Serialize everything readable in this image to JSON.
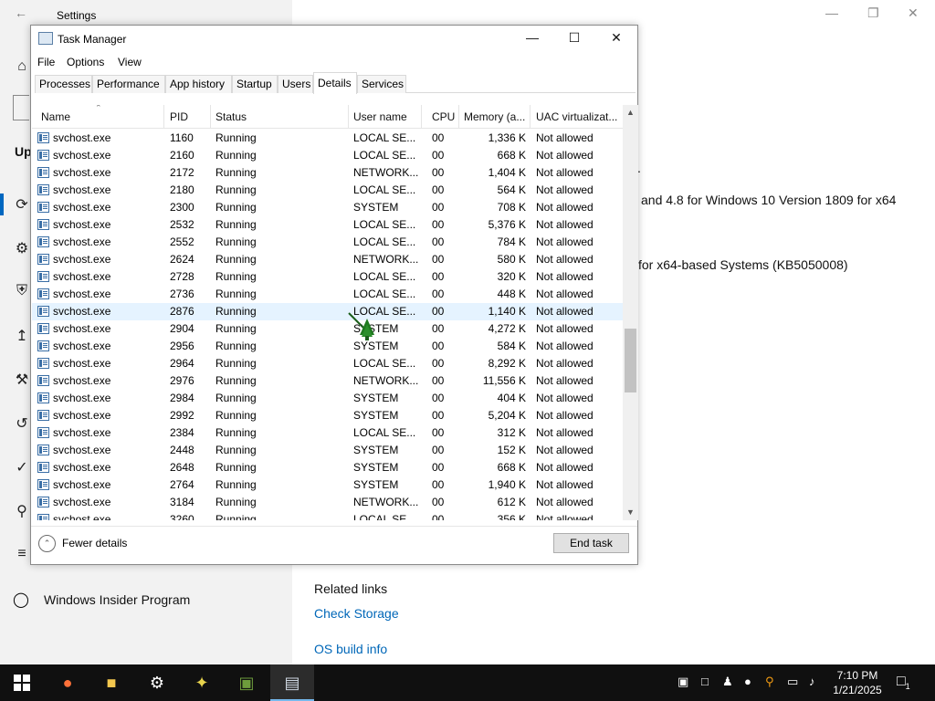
{
  "settings": {
    "title": "Settings",
    "partial_heading": "Up",
    "text_line_1": "and 4.8 for Windows 10 Version 1809 for x64",
    "text_line_2": "for x64-based Systems (KB5050008)",
    "text_dot": ".",
    "related_links": "Related links",
    "check_storage": "Check Storage",
    "os_build_info": "OS build info",
    "insider_program": "Windows Insider Program"
  },
  "task_manager": {
    "title": "Task Manager",
    "menu": [
      "File",
      "Options",
      "View"
    ],
    "tabs": [
      "Processes",
      "Performance",
      "App history",
      "Startup",
      "Users",
      "Details",
      "Services"
    ],
    "active_tab": "Details",
    "columns": [
      "Name",
      "PID",
      "Status",
      "User name",
      "CPU",
      "Memory (a...",
      "UAC virtualizat..."
    ],
    "rows": [
      {
        "name": "svchost.exe",
        "pid": "1160",
        "status": "Running",
        "user": "LOCAL SE...",
        "cpu": "00",
        "memory": "1,336 K",
        "uac": "Not allowed"
      },
      {
        "name": "svchost.exe",
        "pid": "2160",
        "status": "Running",
        "user": "LOCAL SE...",
        "cpu": "00",
        "memory": "668 K",
        "uac": "Not allowed"
      },
      {
        "name": "svchost.exe",
        "pid": "2172",
        "status": "Running",
        "user": "NETWORK...",
        "cpu": "00",
        "memory": "1,404 K",
        "uac": "Not allowed"
      },
      {
        "name": "svchost.exe",
        "pid": "2180",
        "status": "Running",
        "user": "LOCAL SE...",
        "cpu": "00",
        "memory": "564 K",
        "uac": "Not allowed"
      },
      {
        "name": "svchost.exe",
        "pid": "2300",
        "status": "Running",
        "user": "SYSTEM",
        "cpu": "00",
        "memory": "708 K",
        "uac": "Not allowed"
      },
      {
        "name": "svchost.exe",
        "pid": "2532",
        "status": "Running",
        "user": "LOCAL SE...",
        "cpu": "00",
        "memory": "5,376 K",
        "uac": "Not allowed"
      },
      {
        "name": "svchost.exe",
        "pid": "2552",
        "status": "Running",
        "user": "LOCAL SE...",
        "cpu": "00",
        "memory": "784 K",
        "uac": "Not allowed"
      },
      {
        "name": "svchost.exe",
        "pid": "2624",
        "status": "Running",
        "user": "NETWORK...",
        "cpu": "00",
        "memory": "580 K",
        "uac": "Not allowed"
      },
      {
        "name": "svchost.exe",
        "pid": "2728",
        "status": "Running",
        "user": "LOCAL SE...",
        "cpu": "00",
        "memory": "320 K",
        "uac": "Not allowed"
      },
      {
        "name": "svchost.exe",
        "pid": "2736",
        "status": "Running",
        "user": "LOCAL SE...",
        "cpu": "00",
        "memory": "448 K",
        "uac": "Not allowed"
      },
      {
        "name": "svchost.exe",
        "pid": "2876",
        "status": "Running",
        "user": "LOCAL SE...",
        "cpu": "00",
        "memory": "1,140 K",
        "uac": "Not allowed",
        "selected": true
      },
      {
        "name": "svchost.exe",
        "pid": "2904",
        "status": "Running",
        "user": "SYSTEM",
        "cpu": "00",
        "memory": "4,272 K",
        "uac": "Not allowed"
      },
      {
        "name": "svchost.exe",
        "pid": "2956",
        "status": "Running",
        "user": "SYSTEM",
        "cpu": "00",
        "memory": "584 K",
        "uac": "Not allowed"
      },
      {
        "name": "svchost.exe",
        "pid": "2964",
        "status": "Running",
        "user": "LOCAL SE...",
        "cpu": "00",
        "memory": "8,292 K",
        "uac": "Not allowed"
      },
      {
        "name": "svchost.exe",
        "pid": "2976",
        "status": "Running",
        "user": "NETWORK...",
        "cpu": "00",
        "memory": "11,556 K",
        "uac": "Not allowed"
      },
      {
        "name": "svchost.exe",
        "pid": "2984",
        "status": "Running",
        "user": "SYSTEM",
        "cpu": "00",
        "memory": "404 K",
        "uac": "Not allowed"
      },
      {
        "name": "svchost.exe",
        "pid": "2992",
        "status": "Running",
        "user": "SYSTEM",
        "cpu": "00",
        "memory": "5,204 K",
        "uac": "Not allowed"
      },
      {
        "name": "svchost.exe",
        "pid": "2384",
        "status": "Running",
        "user": "LOCAL SE...",
        "cpu": "00",
        "memory": "312 K",
        "uac": "Not allowed"
      },
      {
        "name": "svchost.exe",
        "pid": "2448",
        "status": "Running",
        "user": "SYSTEM",
        "cpu": "00",
        "memory": "152 K",
        "uac": "Not allowed"
      },
      {
        "name": "svchost.exe",
        "pid": "2648",
        "status": "Running",
        "user": "SYSTEM",
        "cpu": "00",
        "memory": "668 K",
        "uac": "Not allowed"
      },
      {
        "name": "svchost.exe",
        "pid": "2764",
        "status": "Running",
        "user": "SYSTEM",
        "cpu": "00",
        "memory": "1,940 K",
        "uac": "Not allowed"
      },
      {
        "name": "svchost.exe",
        "pid": "3184",
        "status": "Running",
        "user": "NETWORK...",
        "cpu": "00",
        "memory": "612 K",
        "uac": "Not allowed"
      },
      {
        "name": "svchost.exe",
        "pid": "3260",
        "status": "Running",
        "user": "LOCAL SE...",
        "cpu": "00",
        "memory": "356 K",
        "uac": "Not allowed"
      }
    ],
    "fewer_details": "Fewer details",
    "end_task": "End task"
  },
  "taskbar": {
    "time": "7:10 PM",
    "date": "1/21/2025",
    "notification_count": "1"
  },
  "colors": {
    "selected_row": "#e5f3ff",
    "link": "#0067b8",
    "taskbar": "#101010",
    "accent": "#0067c0"
  }
}
